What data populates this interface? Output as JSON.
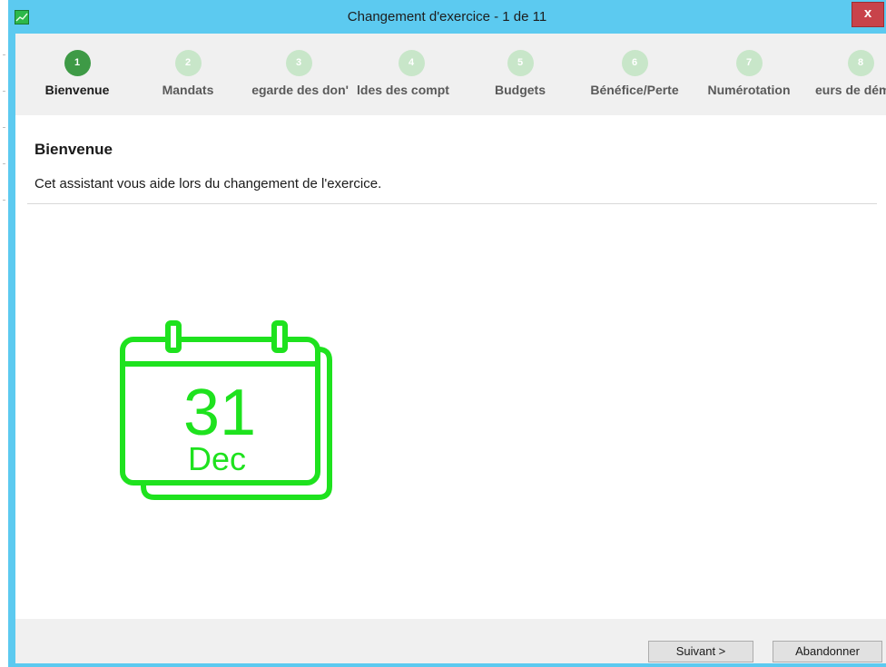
{
  "window": {
    "title": "Changement d'exercice - 1 de 11",
    "close_label": "x"
  },
  "steps": [
    {
      "number": "1",
      "label": "Bienvenue",
      "active": true
    },
    {
      "number": "2",
      "label": "Mandats",
      "active": false
    },
    {
      "number": "3",
      "label": "'egarde des don",
      "active": false
    },
    {
      "number": "4",
      "label": "ldes des compt",
      "active": false
    },
    {
      "number": "5",
      "label": "Budgets",
      "active": false
    },
    {
      "number": "6",
      "label": "Bénéfice/Perte",
      "active": false
    },
    {
      "number": "7",
      "label": "Numérotation",
      "active": false
    },
    {
      "number": "8",
      "label": "eurs de dém",
      "active": false
    }
  ],
  "page": {
    "title": "Bienvenue",
    "description": "Cet assistant vous aide lors du changement de l'exercice."
  },
  "illustration": {
    "icon": "calendar-icon",
    "day": "31",
    "month": "Dec",
    "color": "#1ee21e"
  },
  "footer": {
    "next_label": "Suivant >",
    "cancel_label": "Abandonner"
  },
  "colors": {
    "titlebar": "#5ccaf0",
    "active_step": "#3e9a46",
    "inactive_step": "#c8e6c9",
    "close_button": "#c8434a"
  }
}
